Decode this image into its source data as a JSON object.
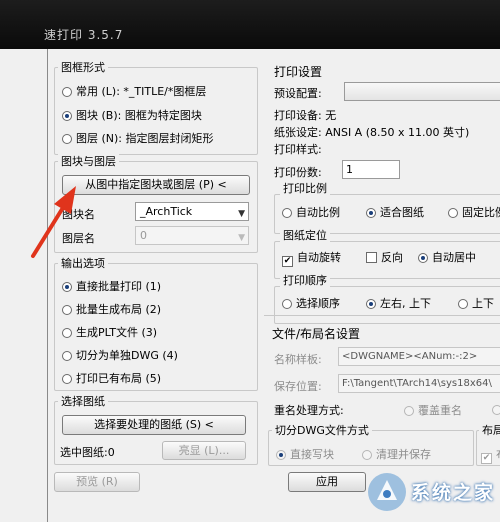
{
  "window": {
    "title": "速打印 3.5.7"
  },
  "frame_group": {
    "title": "图框形式",
    "options": [
      {
        "label": "常用 (L): *_TITLE/*图框层",
        "selected": false
      },
      {
        "label": "图块 (B): 图框为特定图块",
        "selected": true
      },
      {
        "label": "图层 (N): 指定图层封闭矩形",
        "selected": false
      }
    ]
  },
  "block_group": {
    "title": "图块与图层",
    "pick_button": "从图中指定图块或图层 (P) <",
    "block_label": "图块名",
    "block_value": "_ArchTick",
    "layer_label": "图层名",
    "layer_value": "0"
  },
  "output_group": {
    "title": "输出选项",
    "options": [
      {
        "label": "直接批量打印 (1)",
        "selected": true
      },
      {
        "label": "批量生成布局 (2)",
        "selected": false
      },
      {
        "label": "生成PLT文件 (3)",
        "selected": false
      },
      {
        "label": "切分为单独DWG (4)",
        "selected": false
      },
      {
        "label": "打印已有布局 (5)",
        "selected": false
      }
    ]
  },
  "select_group": {
    "title": "选择图纸",
    "select_button": "选择要处理的图纸 (S) <",
    "selected_label": "选中图纸:0",
    "highlight_button": "亮显 (L)..."
  },
  "print_settings": {
    "title": "打印设置",
    "preset_label": "预设配置:",
    "device": "打印设备: 无",
    "paper": "纸张设定: ANSI A (8.50 x 11.00 英寸)",
    "style": "打印样式:",
    "copies_label": "打印份数:",
    "copies_value": "1"
  },
  "scale_group": {
    "title": "打印比例",
    "options": [
      {
        "label": "自动比例",
        "selected": false
      },
      {
        "label": "适合图纸",
        "selected": true
      },
      {
        "label": "固定比例",
        "selected": false
      }
    ]
  },
  "position_group": {
    "title": "图纸定位",
    "auto_rotate": {
      "label": "自动旋转",
      "checked": true
    },
    "reverse": {
      "label": "反向",
      "checked": false
    },
    "auto_center": {
      "label": "自动居中",
      "selected": true
    }
  },
  "order_group": {
    "title": "打印顺序",
    "options": [
      {
        "label": "选择顺序",
        "selected": false
      },
      {
        "label": "左右, 上下",
        "selected": true
      },
      {
        "label": "上下",
        "selected": false
      }
    ]
  },
  "file_group": {
    "title": "文件/布局名设置",
    "template_label": "名称样板:",
    "template_value": "<DWGNAME><ANum:-:2>",
    "save_label": "保存位置:",
    "save_value": "F:\\Tangent\\TArch14\\sys18x64\\",
    "rename_label": "重名处理方式:",
    "overwrite_label": "覆盖重名"
  },
  "split_group": {
    "title": "切分DWG文件方式",
    "options": [
      {
        "label": "直接写块",
        "selected": true
      },
      {
        "label": "清理并保存",
        "selected": false
      }
    ]
  },
  "layout_group": {
    "title": "布局",
    "check_label": "布"
  },
  "buttons": {
    "preview": "预览 (R)",
    "apply": "应用"
  },
  "watermark": {
    "text": "系统之家"
  },
  "colors": {
    "arrow": "#e0341c",
    "selected_dot": "#1a3f7a"
  }
}
